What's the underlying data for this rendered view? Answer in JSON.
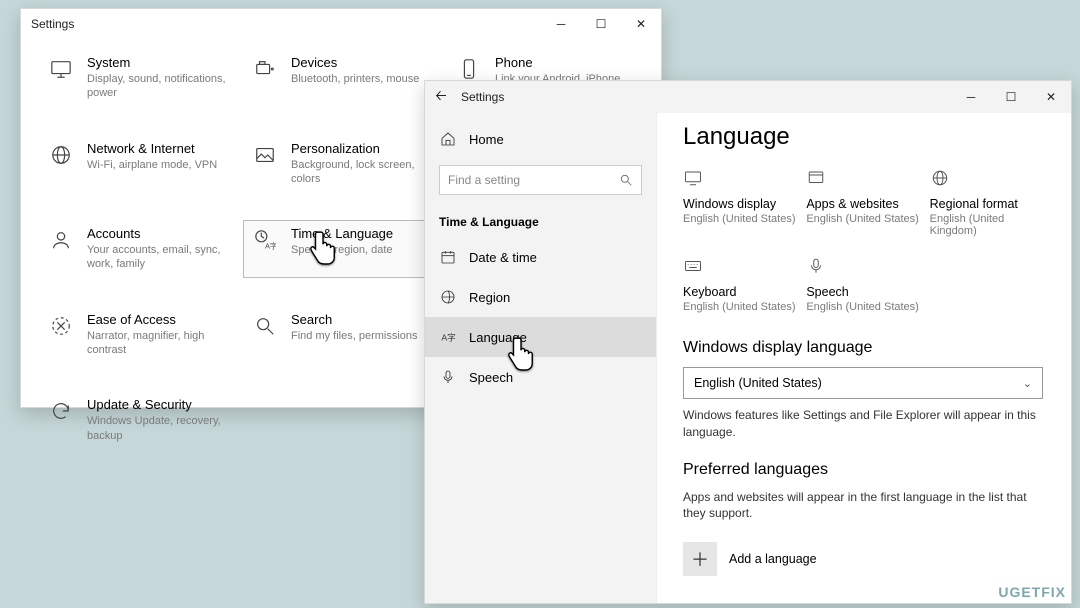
{
  "win1": {
    "title": "Settings",
    "categories": [
      {
        "title": "System",
        "desc": "Display, sound, notifications, power"
      },
      {
        "title": "Devices",
        "desc": "Bluetooth, printers, mouse"
      },
      {
        "title": "Phone",
        "desc": "Link your Android, iPhone"
      },
      {
        "title": "Network & Internet",
        "desc": "Wi-Fi, airplane mode, VPN"
      },
      {
        "title": "Personalization",
        "desc": "Background, lock screen, colors"
      },
      {
        "title": "Accounts",
        "desc": "Your accounts, email, sync, work, family"
      },
      {
        "title": "Time & Language",
        "desc": "Speech, region, date"
      },
      {
        "title": "Ease of Access",
        "desc": "Narrator, magnifier, high contrast"
      },
      {
        "title": "Search",
        "desc": "Find my files, permissions"
      },
      {
        "title": "Update & Security",
        "desc": "Windows Update, recovery, backup"
      }
    ]
  },
  "win2": {
    "title": "Settings",
    "home_label": "Home",
    "search_placeholder": "Find a setting",
    "section_header": "Time & Language",
    "nav": [
      {
        "label": "Date & time"
      },
      {
        "label": "Region"
      },
      {
        "label": "Language"
      },
      {
        "label": "Speech"
      }
    ],
    "page_heading": "Language",
    "tiles": [
      {
        "title": "Windows display",
        "sub": "English (United States)"
      },
      {
        "title": "Apps & websites",
        "sub": "English (United States)"
      },
      {
        "title": "Regional format",
        "sub": "English (United Kingdom)"
      },
      {
        "title": "Keyboard",
        "sub": "English (United States)"
      },
      {
        "title": "Speech",
        "sub": "English (United States)"
      }
    ],
    "display_lang_heading": "Windows display language",
    "display_lang_value": "English (United States)",
    "display_lang_help": "Windows features like Settings and File Explorer will appear in this language.",
    "preferred_heading": "Preferred languages",
    "preferred_help": "Apps and websites will appear in the first language in the list that they support.",
    "add_language_label": "Add a language"
  },
  "watermark": "UGETFIX"
}
